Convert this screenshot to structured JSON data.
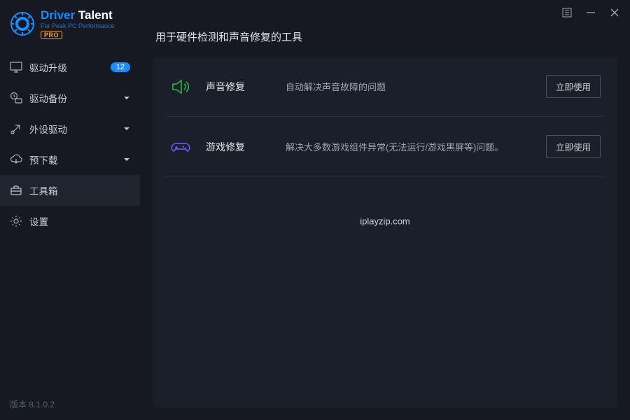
{
  "brand": {
    "name1": "Driver",
    "name2": " Talent",
    "sub": "For Peak PC Performance",
    "pro": "PRO"
  },
  "nav": {
    "items": [
      {
        "label": "驱动升级",
        "badge": "12"
      },
      {
        "label": "驱动备份"
      },
      {
        "label": "外设驱动"
      },
      {
        "label": "预下载"
      },
      {
        "label": "工具箱"
      },
      {
        "label": "设置"
      }
    ]
  },
  "footer": {
    "version": "版本 8.1.0.2"
  },
  "main": {
    "title": "用于硬件检测和声音修复的工具",
    "tools": [
      {
        "name": "声音修复",
        "desc": "自动解决声音故障的问题",
        "btn": "立即使用"
      },
      {
        "name": "游戏修复",
        "desc": "解决大多数游戏组件异常(无法运行/游戏黑屏等)问题。",
        "btn": "立即使用"
      }
    ],
    "watermark": "iplayzip.com"
  }
}
